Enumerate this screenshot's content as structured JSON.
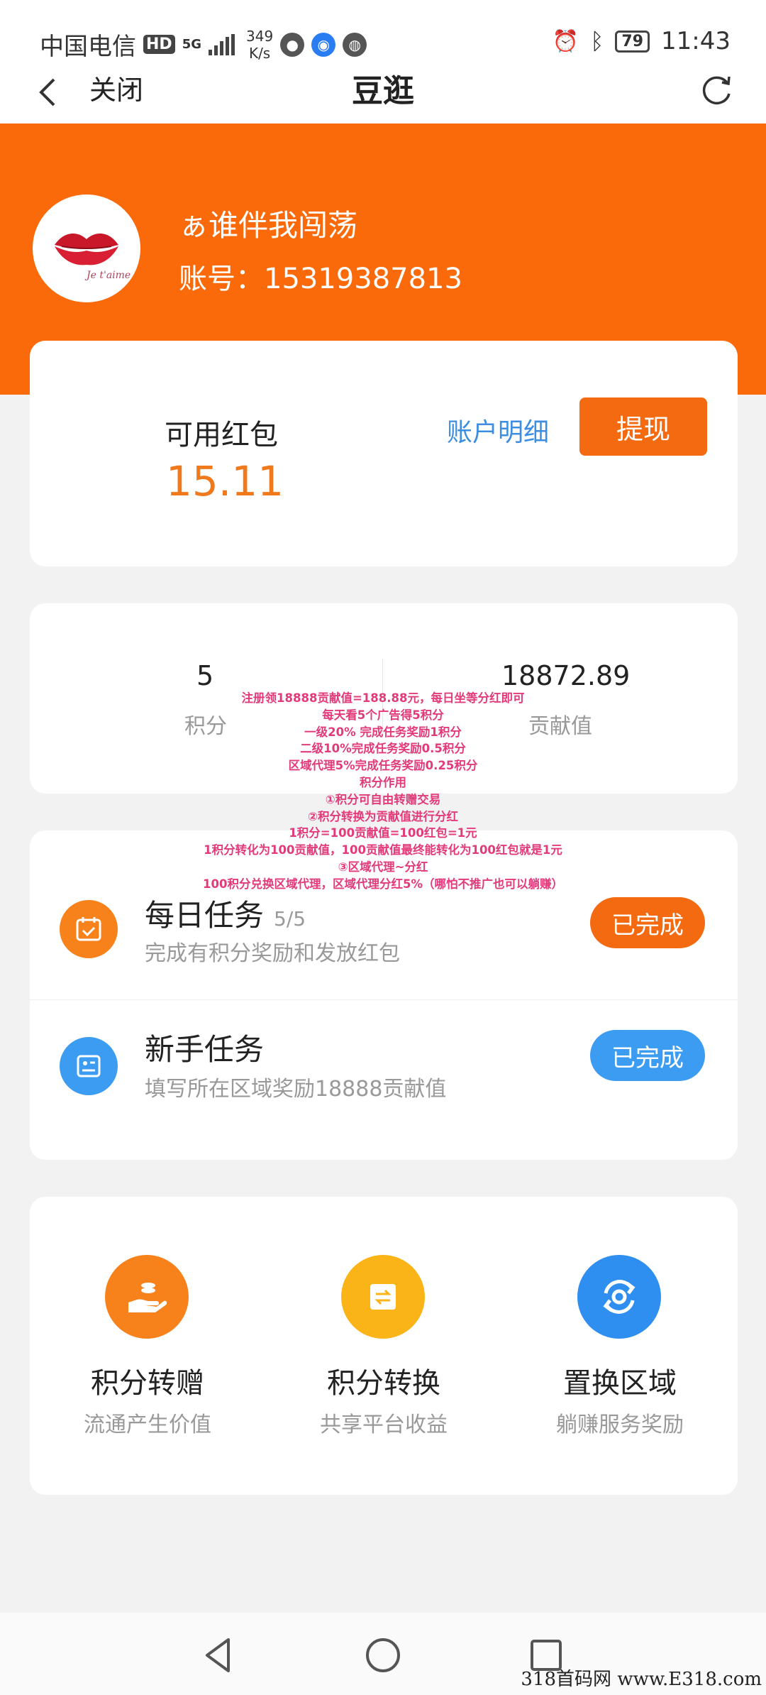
{
  "status_bar": {
    "carrier": "中国电信",
    "hd": "HD",
    "network": "5G",
    "speed_value": "349",
    "speed_unit": "K/s",
    "battery": "79",
    "time": "11:43"
  },
  "nav": {
    "close_label": "关闭",
    "title": "豆逛"
  },
  "user": {
    "name": "ぁ谁伴我闯荡",
    "account": "账号：15319387813"
  },
  "wallet": {
    "label": "可用红包",
    "value": "15.11",
    "detail_link": "账户明细",
    "withdraw_label": "提现"
  },
  "stats": {
    "points_value": "5",
    "points_label": "积分",
    "contribution_value": "18872.89",
    "contribution_label": "贡献值"
  },
  "overlay_notes": [
    "注册领18888贡献值=188.88元，每日坐等分红即可",
    "每天看5个广告得5积分",
    "一级20% 完成任务奖励1积分",
    "二级10%完成任务奖励0.5积分",
    "区域代理5%完成任务奖励0.25积分",
    "积分作用",
    "①积分可自由转赠交易",
    "②积分转换为贡献值进行分红",
    "1积分=100贡献值=100红包=1元",
    "1积分转化为100贡献值，100贡献值最终能转化为100红包就是1元",
    "③区域代理~分红",
    "100积分兑换区域代理，区域代理分红5%（哪怕不推广也可以躺赚）"
  ],
  "tasks": [
    {
      "title": "每日任务",
      "count": "5/5",
      "desc": "完成有积分奖励和发放红包",
      "status": "已完成"
    },
    {
      "title": "新手任务",
      "desc": "填写所在区域奖励18888贡献值",
      "status": "已完成"
    }
  ],
  "features": [
    {
      "title": "积分转赠",
      "desc": "流通产生价值",
      "icon": "hand-coins-icon"
    },
    {
      "title": "积分转换",
      "desc": "共享平台收益",
      "icon": "exchange-icon"
    },
    {
      "title": "置换区域",
      "desc": "躺赚服务奖励",
      "icon": "region-swap-icon"
    }
  ],
  "watermark": "318首码网 www.E318.com",
  "colors": {
    "brand_orange": "#fa6a0a",
    "button_orange": "#f46a10",
    "button_blue": "#3c9cf2",
    "link_blue": "#3d8ee0",
    "overlay_pink": "#e23a7a"
  }
}
